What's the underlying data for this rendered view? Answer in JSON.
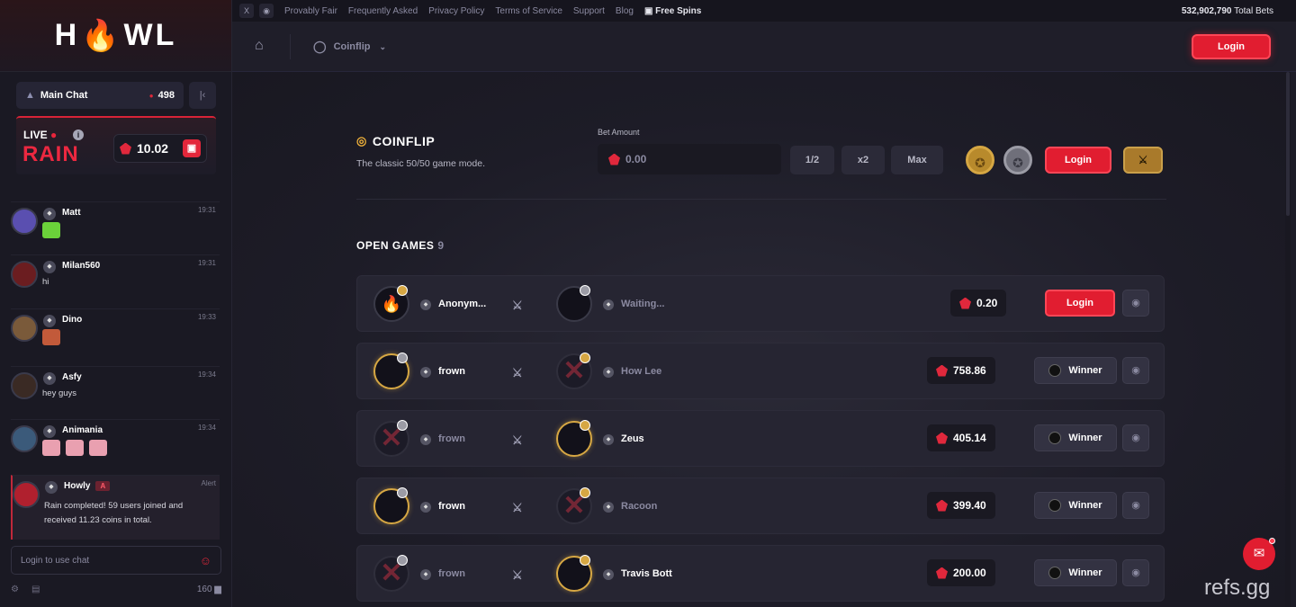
{
  "logo": {
    "text_left": "H",
    "text_right": "WL"
  },
  "sidebar": {
    "chat_tab": {
      "label": "Main Chat",
      "online": "498"
    },
    "rain": {
      "live": "LIVE",
      "title": "RAIN",
      "amount": "10.02"
    },
    "messages": [
      {
        "name": "Matt",
        "time": "19:31",
        "text": "",
        "emotes": 1,
        "avatar_color": "#5a4fb0"
      },
      {
        "name": "Milan560",
        "time": "19:31",
        "text": "hi",
        "emotes": 0,
        "avatar_color": "#6b1d20"
      },
      {
        "name": "Dino",
        "time": "19:33",
        "text": "",
        "emotes": 1,
        "avatar_color": "#7a5a3a"
      },
      {
        "name": "Asfy",
        "time": "19:34",
        "text": "hey guys",
        "emotes": 0,
        "avatar_color": "#3a2a24"
      },
      {
        "name": "Animania",
        "time": "19:34",
        "text": "",
        "emotes": 3,
        "avatar_color": "#3b5a7a"
      },
      {
        "name": "Howly",
        "time": "Alert",
        "badge": "A",
        "text": "Rain completed! 59 users joined and received 11.23 coins in total.",
        "emotes": 0,
        "avatar_color": "#b0202e"
      }
    ],
    "chat_input_placeholder": "Login to use chat",
    "online_count": "160"
  },
  "topbar": {
    "links": [
      "Provably Fair",
      "Frequently Asked",
      "Privacy Policy",
      "Terms of Service",
      "Support",
      "Blog"
    ],
    "free_spins": "Free Spins",
    "total_bets_value": "532,902,790",
    "total_bets_label": "Total Bets"
  },
  "header": {
    "breadcrumb": "Coinflip",
    "login": "Login"
  },
  "coinflip": {
    "title": "COINFLIP",
    "subtitle": "The classic 50/50 game mode.",
    "bet_label": "Bet Amount",
    "bet_value": "0.00",
    "half": "1/2",
    "double": "x2",
    "max": "Max",
    "login": "Login"
  },
  "open_games": {
    "title": "OPEN GAMES",
    "count": "9",
    "rows": [
      {
        "p1": "Anonym...",
        "p1_dim": false,
        "p1_lost": false,
        "p1_side": "gold",
        "p2": "Waiting...",
        "p2_dim": true,
        "p2_lost": false,
        "p2_side": "silver",
        "amount": "0.20",
        "action": "Login"
      },
      {
        "p1": "frown",
        "p1_dim": false,
        "p1_lost": false,
        "p1_side": "silver",
        "p2": "How Lee",
        "p2_dim": true,
        "p2_lost": true,
        "p2_side": "gold",
        "amount": "758.86",
        "action": "Winner"
      },
      {
        "p1": "frown",
        "p1_dim": true,
        "p1_lost": true,
        "p1_side": "silver",
        "p2": "Zeus",
        "p2_dim": false,
        "p2_lost": false,
        "p2_side": "gold",
        "amount": "405.14",
        "action": "Winner"
      },
      {
        "p1": "frown",
        "p1_dim": false,
        "p1_lost": false,
        "p1_side": "silver",
        "p2": "Racoon",
        "p2_dim": true,
        "p2_lost": true,
        "p2_side": "gold",
        "amount": "399.40",
        "action": "Winner"
      },
      {
        "p1": "frown",
        "p1_dim": true,
        "p1_lost": true,
        "p1_side": "silver",
        "p2": "Travis Bott",
        "p2_dim": false,
        "p2_lost": false,
        "p2_side": "gold",
        "amount": "200.00",
        "action": "Winner"
      }
    ]
  },
  "watermark": "refs.gg",
  "colors": {
    "accent": "#e11d30",
    "gold": "#d6a743",
    "bg": "#1d1c27"
  }
}
